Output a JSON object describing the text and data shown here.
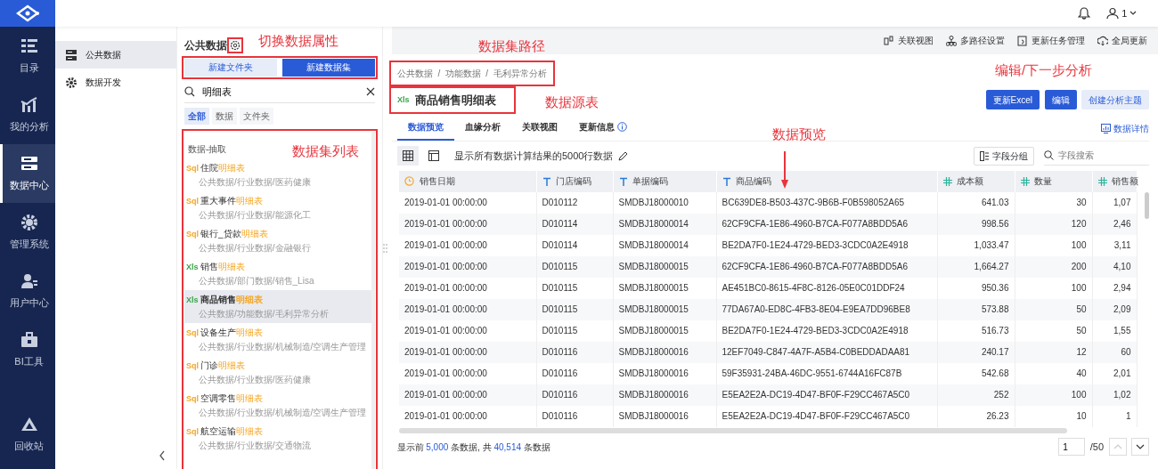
{
  "nav": {
    "items": [
      {
        "label": "目录",
        "selected": false
      },
      {
        "label": "我的分析",
        "selected": false
      },
      {
        "label": "数据中心",
        "selected": true
      },
      {
        "label": "管理系统",
        "selected": false
      },
      {
        "label": "用户中心",
        "selected": false
      },
      {
        "label": "BI工具",
        "selected": false
      }
    ],
    "bottom": {
      "label": "回收站"
    }
  },
  "topbar": {
    "user_count": "1"
  },
  "subnav": {
    "items": [
      {
        "label": "公共数据",
        "selected": true
      },
      {
        "label": "数据开发",
        "selected": false
      }
    ]
  },
  "panel": {
    "title": "公共数据",
    "gear_outlined": true,
    "buttons_outlined": true,
    "buttons": [
      {
        "label": "新建文件夹",
        "kind": "secondary"
      },
      {
        "label": "新建数据集",
        "kind": "primary"
      }
    ],
    "search": {
      "value": "明细表"
    },
    "filters": [
      {
        "label": "全部",
        "selected": true
      },
      {
        "label": "数据",
        "selected": false
      },
      {
        "label": "文件夹",
        "selected": false
      }
    ],
    "list_outlined": true,
    "group": "数据-抽取",
    "items": [
      {
        "kind": "sql",
        "badge": "Sql",
        "name": "住院",
        "match": "明细表",
        "path": "公共数据/行业数据/医药健康",
        "selected": false
      },
      {
        "kind": "sql",
        "badge": "Sql",
        "name": "重大事件",
        "match": "明细表",
        "path": "公共数据/行业数据/能源化工",
        "selected": false
      },
      {
        "kind": "sql",
        "badge": "Sql",
        "name": "银行_贷款",
        "match": "明细表",
        "path": "公共数据/行业数据/金融银行",
        "selected": false
      },
      {
        "kind": "xls",
        "badge": "Xls",
        "name": "销售",
        "match": "明细表",
        "path": "公共数据/部门数据/销售_Lisa",
        "selected": false
      },
      {
        "kind": "xls",
        "badge": "Xls",
        "name": "商品销售",
        "match": "明细表",
        "path": "公共数据/功能数据/毛利异常分析",
        "selected": true
      },
      {
        "kind": "sql",
        "badge": "Sql",
        "name": "设备生产",
        "match": "明细表",
        "path": "公共数据/行业数据/机械制造/空调生产管理",
        "selected": false
      },
      {
        "kind": "sql",
        "badge": "Sql",
        "name": "门诊",
        "match": "明细表",
        "path": "公共数据/行业数据/医药健康",
        "selected": false
      },
      {
        "kind": "sql",
        "badge": "Sql",
        "name": "空调零售",
        "match": "明细表",
        "path": "公共数据/行业数据/机械制造/空调生产管理",
        "selected": false
      },
      {
        "kind": "sql",
        "badge": "Sql",
        "name": "航空运输",
        "match": "明细表",
        "path": "公共数据/行业数据/交通物流",
        "selected": false
      }
    ]
  },
  "toolbar": [
    {
      "label": "关联视图"
    },
    {
      "label": "多路径设置"
    },
    {
      "label": "更新任务管理"
    },
    {
      "label": "全局更新"
    }
  ],
  "detail": {
    "breadcrumb": [
      "公共数据",
      "功能数据",
      "毛利异常分析"
    ],
    "breadcrumb_separator": "/",
    "breadcrumb_outlined": true,
    "title": {
      "badge": "Xls",
      "text": "商品销售明细表",
      "outlined": true
    },
    "actions": [
      {
        "label": "更新Excel",
        "kind": "primary"
      },
      {
        "label": "编辑",
        "kind": "primary"
      },
      {
        "label": "创建分析主题",
        "kind": "light"
      }
    ],
    "tabs": [
      {
        "label": "数据预览",
        "selected": true
      },
      {
        "label": "血缘分析",
        "selected": false
      },
      {
        "label": "关联视图",
        "selected": false
      },
      {
        "label": "更新信息",
        "selected": false,
        "info": true
      }
    ],
    "details_link": "数据详情",
    "views": [
      {
        "selected": true
      },
      {
        "selected": false
      }
    ],
    "note": "显示所有数据计算结果的5000行数据",
    "group_button": "字段分组",
    "field_search": {
      "placeholder": "字段搜索"
    },
    "table": {
      "columns": [
        {
          "label": "销售日期",
          "kind": "date"
        },
        {
          "label": "门店编码",
          "kind": "text"
        },
        {
          "label": "单据编码",
          "kind": "text"
        },
        {
          "label": "商品编码",
          "kind": "text"
        },
        {
          "label": "成本额",
          "kind": "number"
        },
        {
          "label": "数量",
          "kind": "number"
        },
        {
          "label": "销售额",
          "kind": "number"
        }
      ],
      "rows": [
        [
          "2019-01-01 00:00:00",
          "D010112",
          "SMDBJ18000010",
          "BC639DE8-B503-437C-9B6B-F0B598052A65",
          "641.03",
          "30",
          "1,07"
        ],
        [
          "2019-01-01 00:00:00",
          "D010114",
          "SMDBJ18000014",
          "62CF9CFA-1E86-4960-B7CA-F077A8BDD5A6",
          "998.56",
          "120",
          "2,46"
        ],
        [
          "2019-01-01 00:00:00",
          "D010114",
          "SMDBJ18000014",
          "BE2DA7F0-1E24-4729-BED3-3CDC0A2E4918",
          "1,033.47",
          "100",
          "3,11"
        ],
        [
          "2019-01-01 00:00:00",
          "D010115",
          "SMDBJ18000015",
          "62CF9CFA-1E86-4960-B7CA-F077A8BDD5A6",
          "1,664.27",
          "200",
          "4,10"
        ],
        [
          "2019-01-01 00:00:00",
          "D010115",
          "SMDBJ18000015",
          "AE451BC0-8615-4F8C-8126-05E0C01DDF24",
          "950.36",
          "100",
          "2,94"
        ],
        [
          "2019-01-01 00:00:00",
          "D010115",
          "SMDBJ18000015",
          "77DA67A0-ED8C-4FB3-8E04-E9EA7DD96BE8",
          "573.88",
          "50",
          "2,09"
        ],
        [
          "2019-01-01 00:00:00",
          "D010115",
          "SMDBJ18000015",
          "BE2DA7F0-1E24-4729-BED3-3CDC0A2E4918",
          "516.73",
          "50",
          "1,55"
        ],
        [
          "2019-01-01 00:00:00",
          "D010116",
          "SMDBJ18000016",
          "12EF7049-C847-4A7F-A5B4-C0BEDDADAA81",
          "240.17",
          "12",
          "60"
        ],
        [
          "2019-01-01 00:00:00",
          "D010116",
          "SMDBJ18000016",
          "59F35931-24BA-46DC-9551-6744A16FC87B",
          "542.68",
          "40",
          "2,01"
        ],
        [
          "2019-01-01 00:00:00",
          "D010116",
          "SMDBJ18000016",
          "E5EA2E2A-DC19-4D47-BF0F-F29CC467A5C0",
          "252",
          "100",
          "1,02"
        ],
        [
          "2019-01-01 00:00:00",
          "D010116",
          "SMDBJ18000016",
          "E5EA2E2A-DC19-4D47-BF0F-F29CC467A5C0",
          "26.23",
          "10",
          "1"
        ]
      ]
    },
    "footer": [
      {
        "text": "显示前 ",
        "kind": "plain"
      },
      {
        "text": "5,000",
        "kind": "number"
      },
      {
        "text": " 条数据, 共 ",
        "kind": "plain"
      },
      {
        "text": "40,514",
        "kind": "number"
      },
      {
        "text": " 条数据",
        "kind": "plain"
      }
    ],
    "pager": {
      "value": "1",
      "total": "/50",
      "prev_disabled": true,
      "next_disabled": false
    }
  },
  "annotations": [
    {
      "text": "切换数据属性"
    },
    {
      "text": "数据集路径"
    },
    {
      "text": "数据源表"
    },
    {
      "text": "数据集列表"
    },
    {
      "text": "编辑/下一步分析"
    },
    {
      "text": "数据预览",
      "arrow": true
    }
  ]
}
